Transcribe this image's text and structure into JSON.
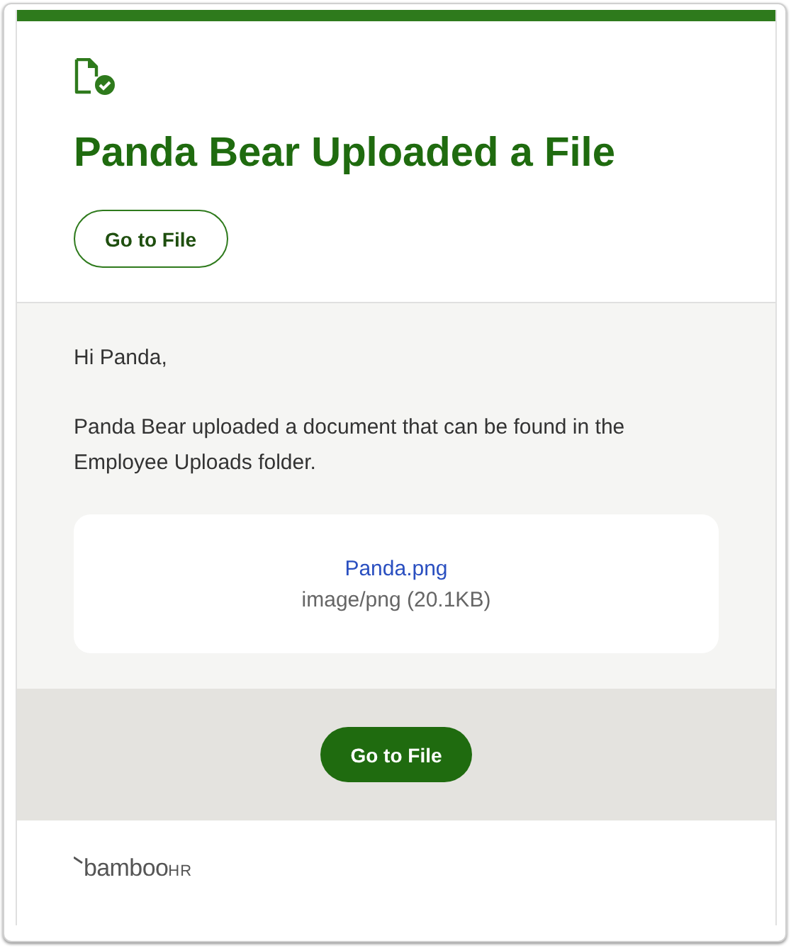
{
  "header": {
    "title": "Panda Bear Uploaded a File",
    "button": "Go to File"
  },
  "body": {
    "greeting": "Hi Panda,",
    "message": "Panda Bear uploaded a document that can be found in the Employee Uploads folder.",
    "file": {
      "name": "Panda.png",
      "meta": "image/png (20.1KB)"
    }
  },
  "action": {
    "button": "Go to File"
  },
  "footer": {
    "logo": {
      "word": "bamboo",
      "suffix": "HR"
    }
  }
}
